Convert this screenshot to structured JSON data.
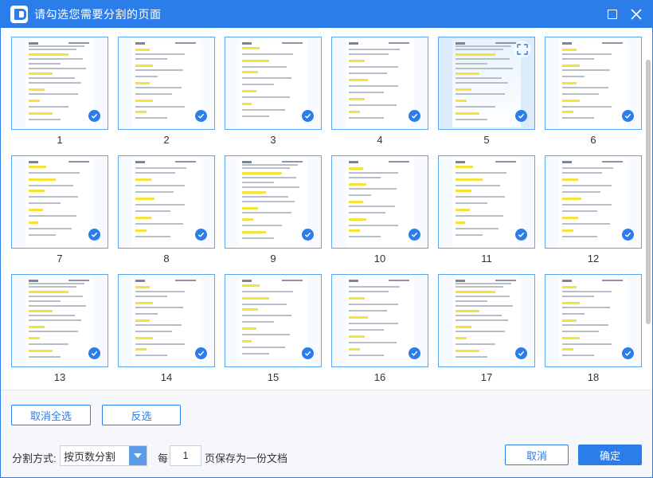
{
  "window": {
    "title": "请勾选您需要分割的页面"
  },
  "pages": [
    {
      "label": "1",
      "selected": true
    },
    {
      "label": "2",
      "selected": true
    },
    {
      "label": "3",
      "selected": true
    },
    {
      "label": "4",
      "selected": true
    },
    {
      "label": "5",
      "selected": true,
      "hovered": true
    },
    {
      "label": "6",
      "selected": true
    },
    {
      "label": "7",
      "selected": true
    },
    {
      "label": "8",
      "selected": true
    },
    {
      "label": "9",
      "selected": true
    },
    {
      "label": "10",
      "selected": true
    },
    {
      "label": "11",
      "selected": true
    },
    {
      "label": "12",
      "selected": true
    },
    {
      "label": "13",
      "selected": true
    },
    {
      "label": "14",
      "selected": true
    },
    {
      "label": "15",
      "selected": true
    },
    {
      "label": "16",
      "selected": true
    },
    {
      "label": "17",
      "selected": true
    },
    {
      "label": "18",
      "selected": true
    }
  ],
  "selection": {
    "deselect_all_label": "取消全选",
    "invert_label": "反选"
  },
  "split": {
    "mode_label": "分割方式:",
    "mode_value": "按页数分割",
    "every_label": "每",
    "pages_value": "1",
    "suffix_label": "页保存为一份文档"
  },
  "actions": {
    "cancel_label": "取消",
    "ok_label": "确定"
  },
  "icons": {
    "logo": "app-logo-icon",
    "maximize": "maximize-icon",
    "close": "close-icon",
    "check": "checkmark-icon",
    "expand": "expand-icon",
    "dropdown": "chevron-down-icon"
  },
  "colors": {
    "accent": "#2b7de9",
    "highlight": "#f6e33a",
    "thumb_border": "#5aa7ef"
  }
}
